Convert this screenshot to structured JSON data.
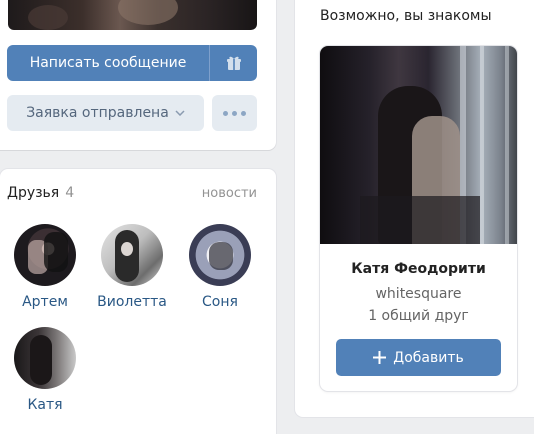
{
  "profile_actions": {
    "message_label": "Написать сообщение",
    "gift_icon": "gift-icon",
    "request_label": "Заявка отправлена",
    "more_icon": "more-dots-icon"
  },
  "friends": {
    "title": "Друзья",
    "count": "4",
    "news_link": "новости",
    "items": [
      {
        "name": "Артем"
      },
      {
        "name": "Виолетта"
      },
      {
        "name": "Соня"
      },
      {
        "name": "Катя"
      }
    ]
  },
  "suggestions": {
    "title": "Возможно, вы знакомы",
    "card": {
      "name": "Катя Феодорити",
      "login": "whitesquare",
      "mutual": "1 общий друг",
      "add_label": "Добавить",
      "add_icon": "plus-icon"
    }
  },
  "colors": {
    "accent": "#5181b8",
    "secondary_button": "#e5ebf1",
    "link": "#2a5885",
    "background": "#edeef0"
  }
}
